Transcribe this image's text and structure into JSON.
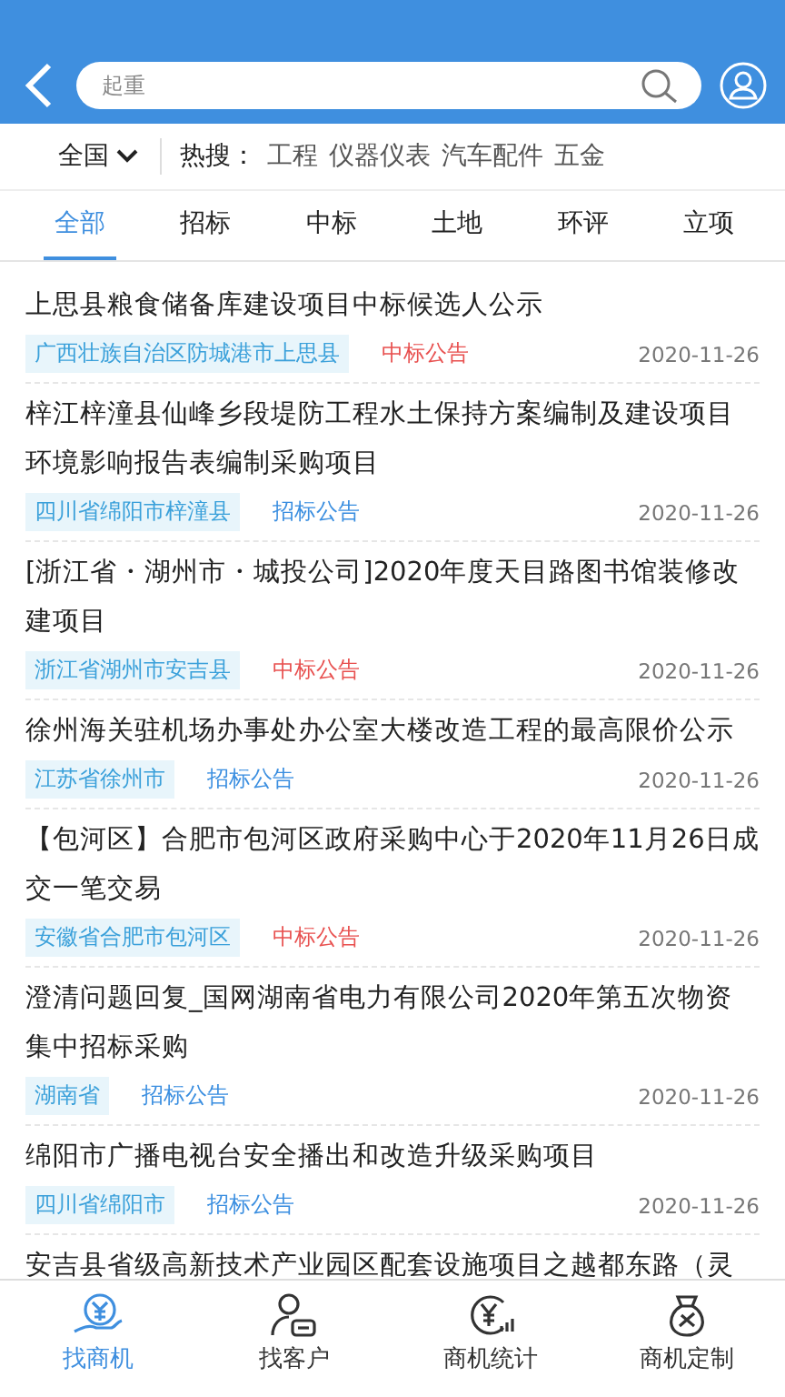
{
  "search": {
    "placeholder": "起重"
  },
  "filter": {
    "region": "全国",
    "hot_label": "热搜：",
    "hot_terms": [
      "工程",
      "仪器仪表",
      "汽车配件",
      "五金"
    ]
  },
  "tabs": [
    {
      "label": "全部",
      "selected": true
    },
    {
      "label": "招标",
      "selected": false
    },
    {
      "label": "中标",
      "selected": false
    },
    {
      "label": "土地",
      "selected": false
    },
    {
      "label": "环评",
      "selected": false
    },
    {
      "label": "立项",
      "selected": false
    }
  ],
  "items": [
    {
      "title": "上思县粮食储备库建设项目中标候选人公示",
      "region": "广西壮族自治区防城港市上思县",
      "type": "中标公告",
      "color": "#e8504f",
      "date": "2020-11-26"
    },
    {
      "title": "梓江梓潼县仙峰乡段堤防工程水土保持方案编制及建设项目环境影响报告表编制采购项目",
      "region": "四川省绵阳市梓潼县",
      "type": "招标公告",
      "color": "#3a8ee0",
      "date": "2020-11-26"
    },
    {
      "title": "[浙江省・湖州市・城投公司]2020年度天目路图书馆装修改建项目",
      "region": "浙江省湖州市安吉县",
      "type": "中标公告",
      "color": "#e8504f",
      "date": "2020-11-26"
    },
    {
      "title": "徐州海关驻机场办事处办公室大楼改造工程的最高限价公示",
      "region": "江苏省徐州市",
      "type": "招标公告",
      "color": "#3a8ee0",
      "date": "2020-11-26"
    },
    {
      "title": "【包河区】合肥市包河区政府采购中心于2020年11月26日成交一笔交易",
      "region": "安徽省合肥市包河区",
      "type": "中标公告",
      "color": "#e8504f",
      "date": "2020-11-26"
    },
    {
      "title": "澄清问题回复_国网湖南省电力有限公司2020年第五次物资集中招标采购",
      "region": "湖南省",
      "type": "招标公告",
      "color": "#3a8ee0",
      "date": "2020-11-26"
    },
    {
      "title": "绵阳市广播电视台安全播出和改造升级采购项目",
      "region": "四川省绵阳市",
      "type": "招标公告",
      "color": "#3a8ee0",
      "date": "2020-11-26"
    },
    {
      "title": "安吉县省级高新技术产业园区配套设施项目之越都东路（灵"
    }
  ],
  "nav": [
    {
      "label": "找商机",
      "selected": true
    },
    {
      "label": "找客户",
      "selected": false
    },
    {
      "label": "商机统计",
      "selected": false
    },
    {
      "label": "商机定制",
      "selected": false
    }
  ]
}
